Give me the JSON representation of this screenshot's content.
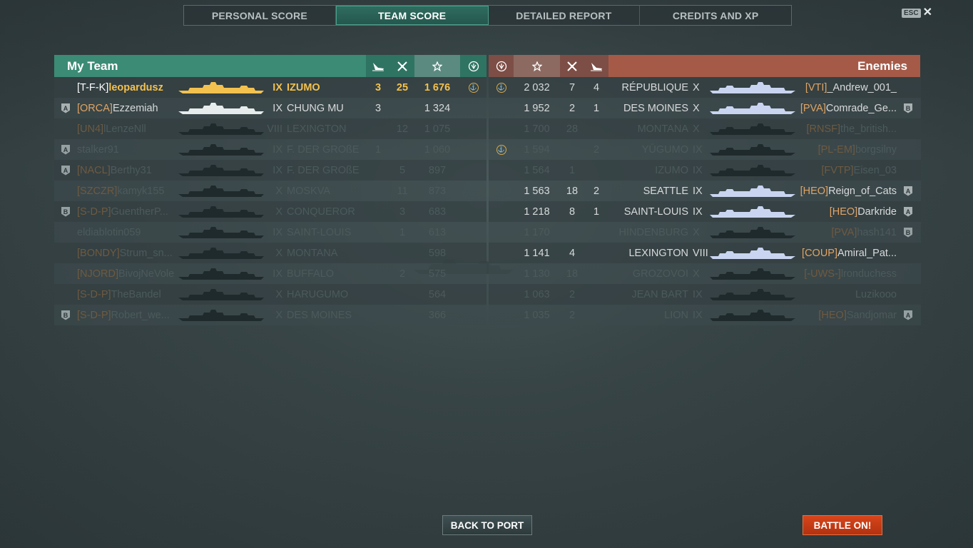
{
  "tabs": [
    {
      "label": "PERSONAL SCORE",
      "active": false
    },
    {
      "label": "TEAM SCORE",
      "active": true
    },
    {
      "label": "DETAILED REPORT",
      "active": false
    },
    {
      "label": "CREDITS AND XP",
      "active": false
    }
  ],
  "esc": {
    "key": "ESC",
    "icon": "close-icon"
  },
  "my_team": {
    "title": "My Team",
    "header_icons": [
      "ship-sunk-icon",
      "planes-destroyed-icon",
      "star-icon",
      "achievement-icon"
    ],
    "rows": [
      {
        "division": "",
        "clan": "[T-F-K]",
        "name": "leopardusz",
        "tier": "IX",
        "ship": "IZUMO",
        "stat1": "3",
        "stat2": "25",
        "xp": "1 676",
        "medal": true,
        "me": true,
        "dim": false
      },
      {
        "division": "A",
        "clan": "[ORCA]",
        "name": "Ezzemiah",
        "tier": "IX",
        "ship": "CHUNG MU",
        "stat1": "3",
        "stat2": "",
        "xp": "1 324",
        "medal": false,
        "me": false,
        "dim": false
      },
      {
        "division": "",
        "clan": "[UN4]",
        "name": "lLenzeNll",
        "tier": "VIII",
        "ship": "LEXINGTON",
        "stat1": "",
        "stat2": "12",
        "xp": "1 075",
        "medal": false,
        "me": false,
        "dim": true
      },
      {
        "division": "A",
        "clan": "",
        "name": "stalker91",
        "tier": "IX",
        "ship": "F. DER GROßE",
        "stat1": "1",
        "stat2": "",
        "xp": "1 060",
        "medal": false,
        "me": false,
        "dim": true
      },
      {
        "division": "A",
        "clan": "[NACL]",
        "name": "Berthy31",
        "tier": "IX",
        "ship": "F. DER GROßE",
        "stat1": "",
        "stat2": "5",
        "xp": "897",
        "medal": false,
        "me": false,
        "dim": true
      },
      {
        "division": "",
        "clan": "[SZCZR]",
        "name": "kamyk155",
        "tier": "X",
        "ship": "MOSKVA",
        "stat1": "",
        "stat2": "11",
        "xp": "873",
        "medal": false,
        "me": false,
        "dim": true
      },
      {
        "division": "B",
        "clan": "[S-D-P]",
        "name": "GuentherP...",
        "tier": "X",
        "ship": "CONQUEROR",
        "stat1": "",
        "stat2": "3",
        "xp": "683",
        "medal": false,
        "me": false,
        "dim": true
      },
      {
        "division": "",
        "clan": "",
        "name": "eldiablotin059",
        "tier": "IX",
        "ship": "SAINT-LOUIS",
        "stat1": "",
        "stat2": "1",
        "xp": "613",
        "medal": false,
        "me": false,
        "dim": true
      },
      {
        "division": "",
        "clan": "[BONDY]",
        "name": "Strum_sn...",
        "tier": "X",
        "ship": "MONTANA",
        "stat1": "",
        "stat2": "",
        "xp": "598",
        "medal": false,
        "me": false,
        "dim": true
      },
      {
        "division": "",
        "clan": "[NJORD]",
        "name": "BivojNeVole",
        "tier": "IX",
        "ship": "BUFFALO",
        "stat1": "",
        "stat2": "2",
        "xp": "575",
        "medal": false,
        "me": false,
        "dim": true
      },
      {
        "division": "",
        "clan": "[S-D-P]",
        "name": "TheBandel",
        "tier": "X",
        "ship": "HARUGUMO",
        "stat1": "",
        "stat2": "",
        "xp": "564",
        "medal": false,
        "me": false,
        "dim": true
      },
      {
        "division": "B",
        "clan": "[S-D-P]",
        "name": "Robert_we...",
        "tier": "X",
        "ship": "DES MOINES",
        "stat1": "",
        "stat2": "",
        "xp": "366",
        "medal": false,
        "me": false,
        "dim": true
      }
    ]
  },
  "enemies": {
    "title": "Enemies",
    "header_icons": [
      "achievement-icon",
      "star-icon",
      "planes-destroyed-icon",
      "ship-sunk-icon"
    ],
    "rows": [
      {
        "medal": true,
        "xp": "2 032",
        "stat2": "7",
        "stat1": "4",
        "ship": "RÉPUBLIQUE",
        "tier": "X",
        "clan": "[VTI]",
        "name": "_Andrew_001_",
        "division": "",
        "dim": false
      },
      {
        "medal": false,
        "xp": "1 952",
        "stat2": "2",
        "stat1": "1",
        "ship": "DES MOINES",
        "tier": "X",
        "clan": "[PVA]",
        "name": "Comrade_Ge...",
        "division": "B",
        "dim": false
      },
      {
        "medal": false,
        "xp": "1 700",
        "stat2": "28",
        "stat1": "",
        "ship": "MONTANA",
        "tier": "X",
        "clan": "[RNSF]",
        "name": "the_british...",
        "division": "",
        "dim": true
      },
      {
        "medal": true,
        "xp": "1 594",
        "stat2": "",
        "stat1": "2",
        "ship": "YŪGUMO",
        "tier": "IX",
        "clan": "[PL-EM]",
        "name": "borgsilny",
        "division": "",
        "dim": true
      },
      {
        "medal": false,
        "xp": "1 564",
        "stat2": "1",
        "stat1": "",
        "ship": "IZUMO",
        "tier": "IX",
        "clan": "[FVTP]",
        "name": "Eisen_03",
        "division": "",
        "dim": true
      },
      {
        "medal": false,
        "xp": "1 563",
        "stat2": "18",
        "stat1": "2",
        "ship": "SEATTLE",
        "tier": "IX",
        "clan": "[HEO]",
        "name": "Reign_of_Cats",
        "division": "A",
        "dim": false
      },
      {
        "medal": false,
        "xp": "1 218",
        "stat2": "8",
        "stat1": "1",
        "ship": "SAINT-LOUIS",
        "tier": "IX",
        "clan": "[HEO]",
        "name": "Darkride",
        "division": "A",
        "dim": false
      },
      {
        "medal": false,
        "xp": "1 170",
        "stat2": "",
        "stat1": "",
        "ship": "HINDENBURG",
        "tier": "X",
        "clan": "[PVA]",
        "name": "hash141",
        "division": "B",
        "dim": true
      },
      {
        "medal": false,
        "xp": "1 141",
        "stat2": "4",
        "stat1": "",
        "ship": "LEXINGTON",
        "tier": "VIII",
        "clan": "[COUP]",
        "name": "Amiral_Pat...",
        "division": "",
        "dim": false
      },
      {
        "medal": false,
        "xp": "1 130",
        "stat2": "18",
        "stat1": "",
        "ship": "GROZOVOI",
        "tier": "X",
        "clan": "[-UWS-]",
        "name": "lronduchess",
        "division": "",
        "dim": true
      },
      {
        "medal": false,
        "xp": "1 063",
        "stat2": "2",
        "stat1": "",
        "ship": "JEAN BART",
        "tier": "IX",
        "clan": "",
        "name": "Luzikooo",
        "division": "",
        "dim": true
      },
      {
        "medal": false,
        "xp": "1 035",
        "stat2": "2",
        "stat1": "",
        "ship": "LION",
        "tier": "IX",
        "clan": "[HEO]",
        "name": "Sandjomar",
        "division": "A",
        "dim": true
      }
    ]
  },
  "buttons": {
    "back_to_port": "BACK TO PORT",
    "battle_on": "BATTLE ON!"
  },
  "colors": {
    "my_team": "#3c8b75",
    "enemies": "#a55a48",
    "clan_tag": "#e0a464",
    "player_highlight": "#f3c14e",
    "battle_button": "#d8451a"
  }
}
